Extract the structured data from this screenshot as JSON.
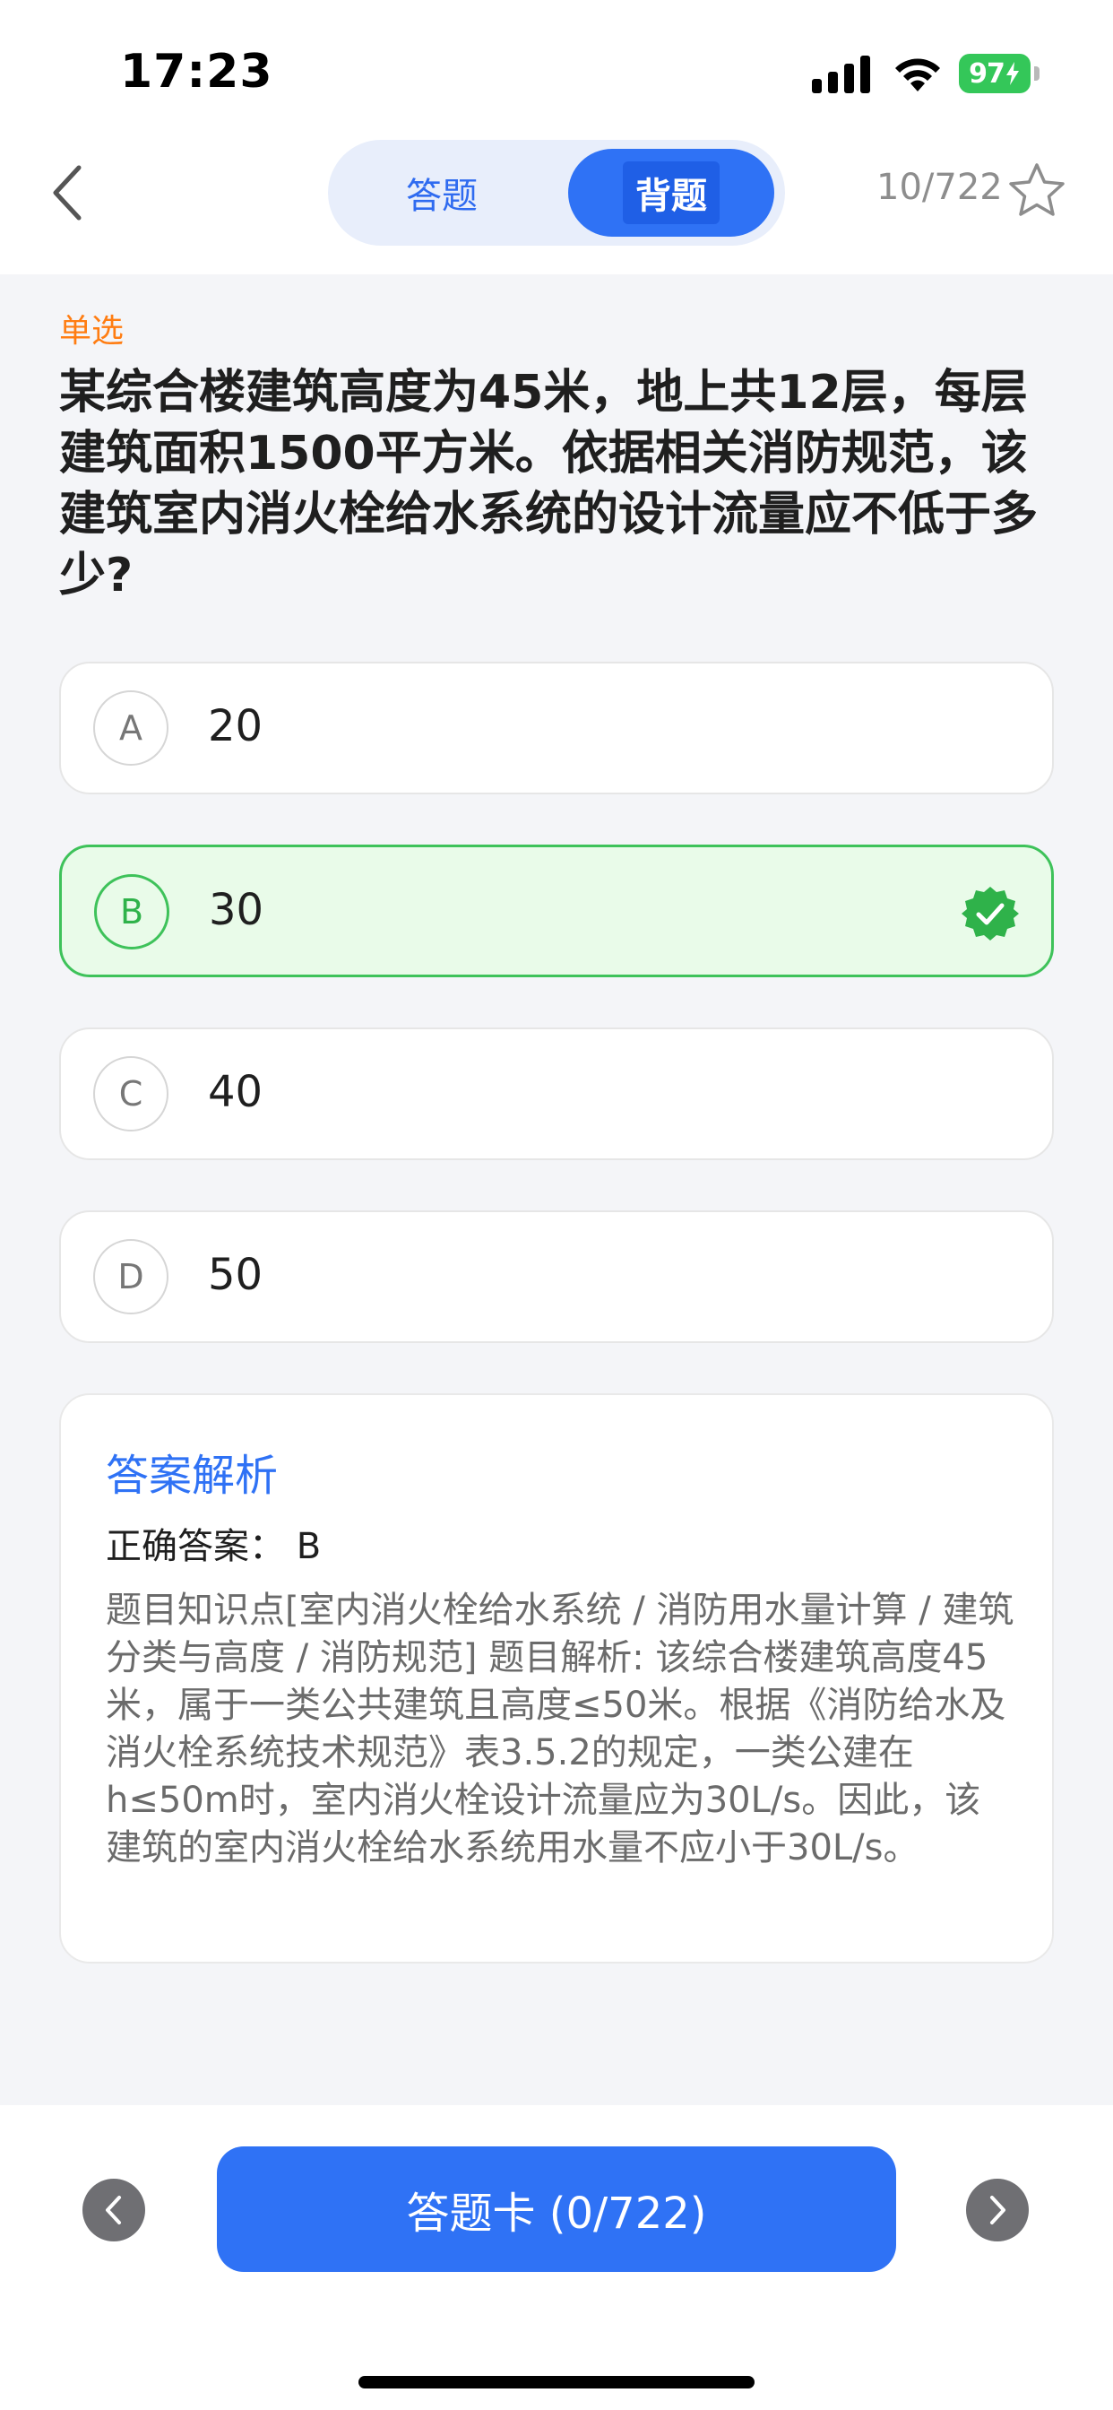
{
  "status_bar": {
    "time": "17:23",
    "battery": "97"
  },
  "nav": {
    "tab_answer": "答题",
    "tab_recite": "背题",
    "progress": "10/722"
  },
  "question": {
    "type": "单选",
    "text": "某综合楼建筑高度为45米，地上共12层，每层建筑面积1500平方米。依据相关消防规范，该建筑室内消火栓给水系统的设计流量应不低于多少?"
  },
  "options": [
    {
      "letter": "A",
      "text": "20",
      "correct": false
    },
    {
      "letter": "B",
      "text": "30",
      "correct": true
    },
    {
      "letter": "C",
      "text": "40",
      "correct": false
    },
    {
      "letter": "D",
      "text": "50",
      "correct": false
    }
  ],
  "analysis": {
    "title": "答案解析",
    "correct_label": "正确答案：",
    "correct_value": "B",
    "body": "题目知识点[室内消火栓给水系统 / 消防用水量计算 / 建筑分类与高度 / 消防规范] 题目解析: 该综合楼建筑高度45米，属于一类公共建筑且高度≤50米。根据《消防给水及消火栓系统技术规范》表3.5.2的规定，一类公建在h≤50m时，室内消火栓设计流量应为30L/s。因此，该建筑的室内消火栓给水系统用水量不应小于30L/s。"
  },
  "bottom": {
    "answer_card": "答题卡 (0/722)"
  },
  "colors": {
    "accent": "#2f72f5",
    "correct": "#3ec25a",
    "type_label": "#ff7d12"
  }
}
